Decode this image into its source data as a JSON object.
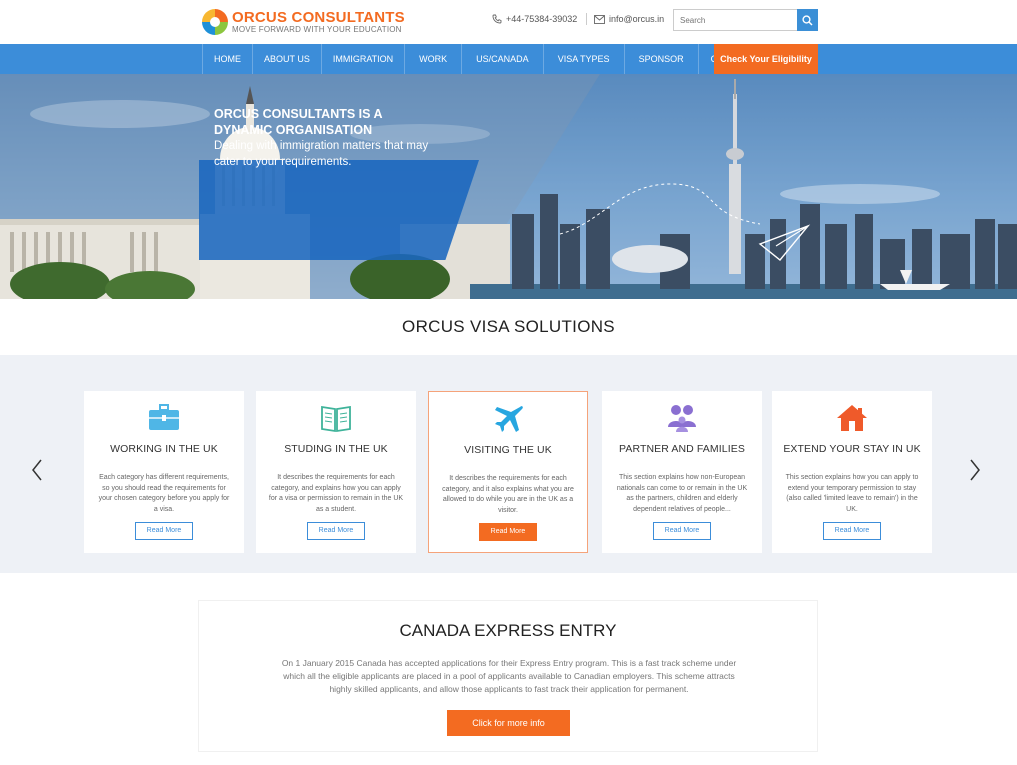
{
  "brand": {
    "name": "ORCUS CONSULTANTS",
    "tagline": "MOVE FORWARD WITH YOUR EDUCATION"
  },
  "topbar": {
    "phone": "+44-75384-39032",
    "email": "info@orcus.in",
    "search_placeholder": "Search"
  },
  "nav": {
    "items": [
      {
        "label": "HOME"
      },
      {
        "label": "ABOUT US"
      },
      {
        "label": "IMMIGRATION"
      },
      {
        "label": "WORK"
      },
      {
        "label": "US/CANADA"
      },
      {
        "label": "VISA TYPES"
      },
      {
        "label": "SPONSOR"
      },
      {
        "label": "CONTACT"
      }
    ],
    "cta": "Check Your Eligibility"
  },
  "hero": {
    "title": "ORCUS CONSULTANTS IS A DYNAMIC ORGANISATION",
    "subtitle": "Dealing with immigration matters that may cater to your requirements."
  },
  "solutions": {
    "title": "ORCUS VISA SOLUTIONS",
    "cards": [
      {
        "icon": "briefcase-icon",
        "title": "WORKING IN THE UK",
        "desc": "Each category has different requirements, so you should read the requirements for your chosen category before you apply for a visa.",
        "button": "Read More",
        "color": "#4fb6e6"
      },
      {
        "icon": "book-icon",
        "title": "STUDING IN THE UK",
        "desc": "It describes the requirements for each category, and explains how you can apply for a visa or permission to remain in the UK as a student.",
        "button": "Read More",
        "color": "#3fb39a"
      },
      {
        "icon": "airplane-icon",
        "title": "VISITING THE UK",
        "desc": "It describes the requirements for each category, and it also explains what you are allowed to do while you are in the UK as a visitor.",
        "button": "Read More",
        "color": "#27a6e0"
      },
      {
        "icon": "family-icon",
        "title": "PARTNER AND FAMILIES",
        "desc": "This section explains how non-European nationals can come to or remain in the UK as the partners, children and elderly dependent relatives of people...",
        "button": "Read More",
        "color": "#8a6fd1"
      },
      {
        "icon": "home-icon",
        "title": "EXTEND YOUR STAY IN UK",
        "desc": "This section explains how you can apply to extend your temporary permission to stay (also called 'limited leave to remain') in the UK.",
        "button": "Read More",
        "color": "#ef5a2a"
      }
    ]
  },
  "canada": {
    "title": "CANADA EXPRESS ENTRY",
    "text": "On 1 January 2015 Canada has accepted applications for their Express Entry program. This is a fast track scheme under which all the eligible applicants are placed in a pool of applicants available to Canadian employers. This scheme attracts highly skilled applicants, and allow those applicants to fast track their application for permanent.",
    "button": "Click for more info"
  },
  "colors": {
    "primary": "#3c8dd9",
    "accent": "#f36b21",
    "band": "#eef1f6"
  }
}
